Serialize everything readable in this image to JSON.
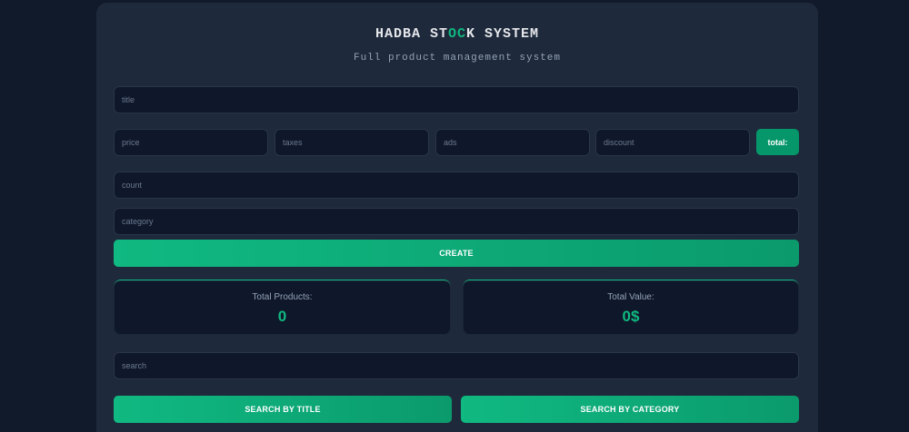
{
  "header": {
    "title_part1": "HADBA ST",
    "title_accent": "OC",
    "title_part2": "K SYSTEM",
    "subtitle": "Full product management system"
  },
  "form": {
    "title_placeholder": "title",
    "price_placeholder": "price",
    "taxes_placeholder": "taxes",
    "ads_placeholder": "ads",
    "discount_placeholder": "discount",
    "total_label": "total:",
    "count_placeholder": "count",
    "category_placeholder": "category",
    "create_label": "CREATE"
  },
  "stats": {
    "products_label": "Total Products:",
    "products_value": "0",
    "value_label": "Total Value:",
    "value_value": "0$"
  },
  "search": {
    "placeholder": "search",
    "by_title_label": "SEARCH BY TITLE",
    "by_category_label": "SEARCH BY CATEGORY"
  },
  "colors": {
    "background": "#111a2b",
    "card": "#1e293b",
    "input": "#0f172a",
    "accent": "#10b981"
  }
}
